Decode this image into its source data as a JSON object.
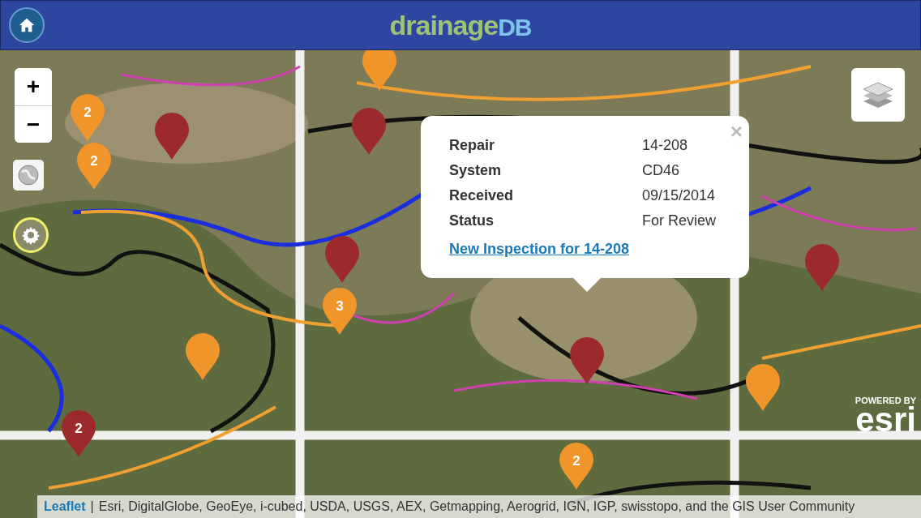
{
  "header": {
    "logo_main": "drainage",
    "logo_accent": "DB"
  },
  "map": {
    "kind": "picture",
    "markers": [
      {
        "color": "#f0952a",
        "count": "2"
      },
      {
        "color": "#f0952a",
        "count": "2"
      },
      {
        "color": "#9c2a2c"
      },
      {
        "color": "#f0952a"
      },
      {
        "color": "#9c2a2c"
      },
      {
        "color": "#9c2a2c"
      },
      {
        "color": "#f0952a",
        "count": "3"
      },
      {
        "color": "#f0952a"
      },
      {
        "color": "#9c2a2c"
      },
      {
        "color": "#f0952a"
      },
      {
        "color": "#9c2a2c"
      },
      {
        "color": "#9c2a2c",
        "count": "2"
      },
      {
        "color": "#f0952a",
        "count": "2"
      }
    ]
  },
  "popup": {
    "close": "×",
    "rows": [
      {
        "label": "Repair",
        "value": "14-208"
      },
      {
        "label": "System",
        "value": "CD46"
      },
      {
        "label": "Received",
        "value": "09/15/2014"
      },
      {
        "label": "Status",
        "value": "For Review"
      }
    ],
    "link": "New Inspection for 14-208"
  },
  "zoom_controls": [
    "+",
    "−"
  ],
  "esri": {
    "tagline": "POWERED BY",
    "brand": "esri"
  },
  "attribution": {
    "link": "Leaflet",
    "separator": "|",
    "text": "Esri, DigitalGlobe, GeoEye, i-cubed, USDA, USGS, AEX, Getmapping, Aerogrid, IGN, IGP, swisstopo, and the GIS User Community"
  }
}
